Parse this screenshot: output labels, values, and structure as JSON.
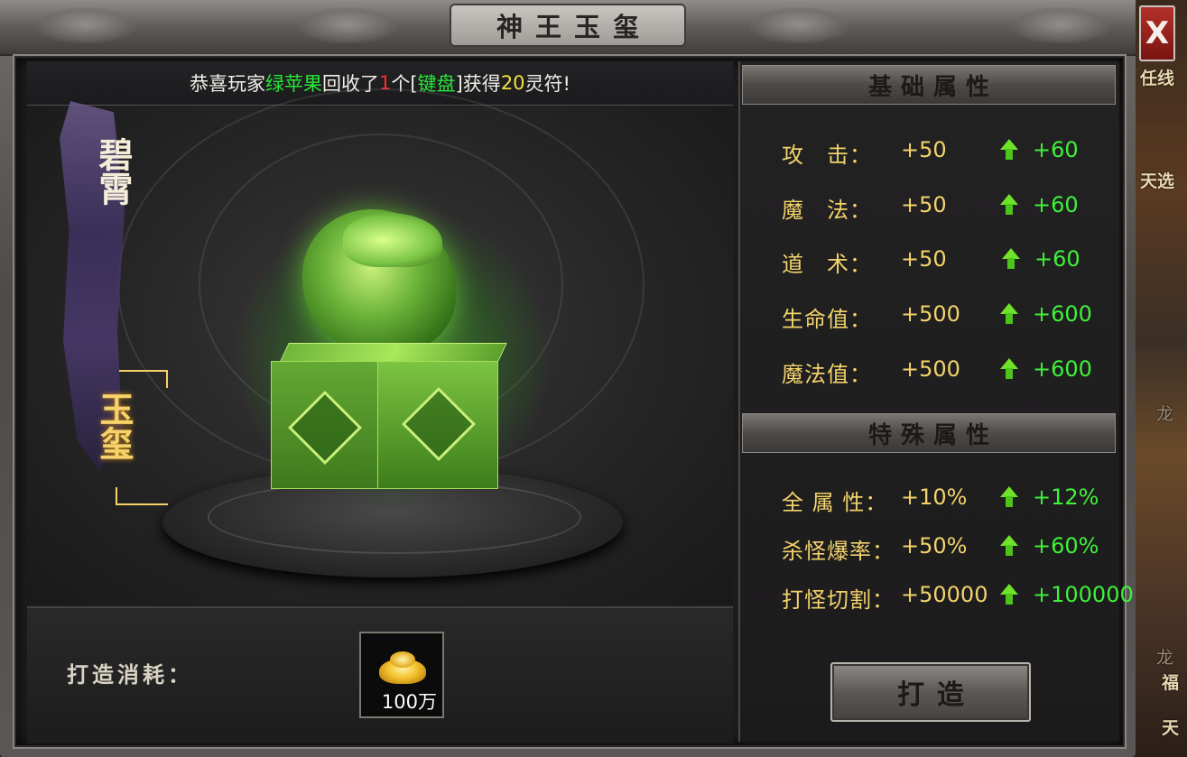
{
  "window": {
    "title": "神王玉玺",
    "close_label": "X"
  },
  "announcement": {
    "prefix": "恭喜玩家",
    "player": "绿苹果",
    "mid": "回收了",
    "count": "1",
    "unit": "个[",
    "item": "键盘",
    "after_item": "]获得",
    "reward": "20",
    "suffix": "灵符!"
  },
  "item_label": {
    "name": "碧霄",
    "type": "玉玺"
  },
  "cost": {
    "label": "打造消耗：",
    "item_icon": "gold-ingot-icon",
    "amount": "100万"
  },
  "base_attributes": {
    "heading": "基础属性",
    "rows": [
      {
        "label": "攻　击：",
        "current": "+50",
        "next": "+60"
      },
      {
        "label": "魔　法：",
        "current": "+50",
        "next": "+60"
      },
      {
        "label": "道　术：",
        "current": "+50",
        "next": "+60"
      },
      {
        "label": "生命值：",
        "current": "+500",
        "next": "+600"
      },
      {
        "label": "魔法值：",
        "current": "+500",
        "next": "+600"
      }
    ]
  },
  "special_attributes": {
    "heading": "特殊属性",
    "rows": [
      {
        "label": "全 属 性：",
        "current": "+10%",
        "next": "+12%"
      },
      {
        "label": "杀怪爆率：",
        "current": "+50%",
        "next": "+60%"
      },
      {
        "label": "打怪切割：",
        "current": "+50000",
        "next": "+100000"
      }
    ]
  },
  "forge_button": {
    "label": "打造"
  },
  "background_scene": {
    "texts": [
      "任线",
      "天选",
      "龙",
      "龙",
      "福",
      "天"
    ]
  },
  "colors": {
    "attr_label": "#f2d36b",
    "attr_up": "#3ff03a",
    "highlight_green": "#28e63a",
    "highlight_yellow": "#f2e23a",
    "highlight_red": "#ff2d2d",
    "close_red": "#b3302a"
  }
}
